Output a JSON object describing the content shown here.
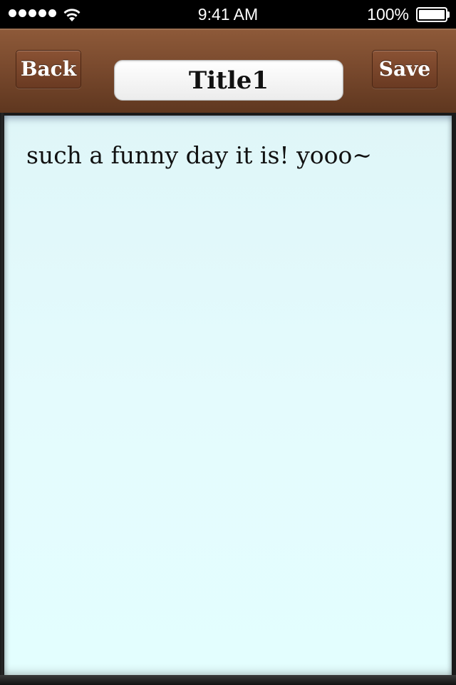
{
  "status_bar": {
    "time": "9:41 AM",
    "battery_percent": "100%",
    "signal_bars": 5,
    "icons": [
      "signal-dots-icon",
      "wifi-icon",
      "battery-icon"
    ]
  },
  "nav": {
    "back_label": "Back",
    "title_value": "Title1",
    "save_label": "Save"
  },
  "note": {
    "body": "such a funny day it is! yooo~"
  },
  "colors": {
    "nav_brown": "#7a4a2e",
    "paper": "#e2fafc",
    "status_bar": "#000000"
  }
}
